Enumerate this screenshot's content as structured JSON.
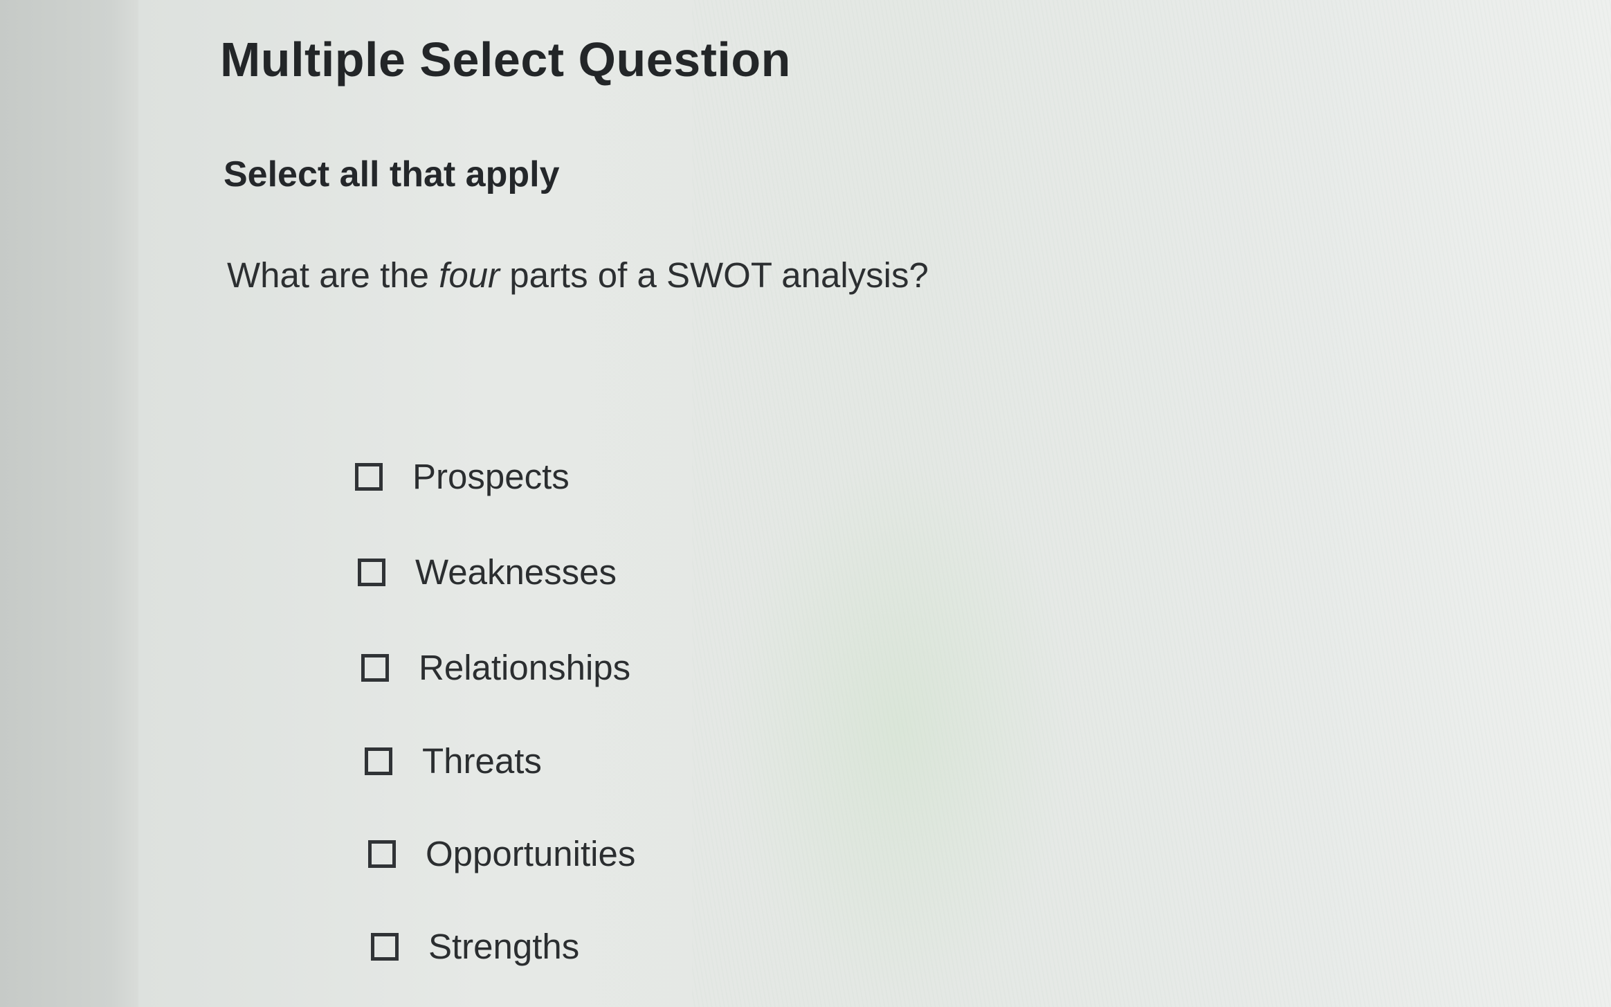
{
  "question": {
    "type_title": "Multiple Select Question",
    "instruction": "Select all that apply",
    "prompt_before": "What are the ",
    "prompt_emphasis": "four",
    "prompt_after": " parts of a SWOT analysis?"
  },
  "options": [
    {
      "label": "Prospects",
      "checked": false
    },
    {
      "label": "Weaknesses",
      "checked": false
    },
    {
      "label": "Relationships",
      "checked": false
    },
    {
      "label": "Threats",
      "checked": false
    },
    {
      "label": "Opportunities",
      "checked": false
    },
    {
      "label": "Strengths",
      "checked": false
    }
  ]
}
